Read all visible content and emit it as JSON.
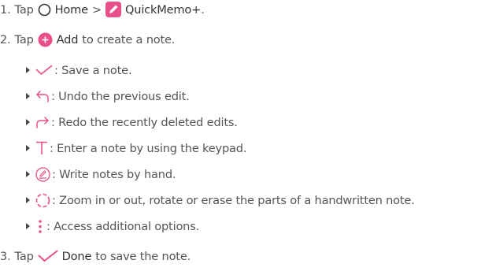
{
  "colors": {
    "accent": "#e94f8a",
    "text": "#555555",
    "strong": "#333333"
  },
  "steps": [
    {
      "num": "1.",
      "pre": "Tap",
      "home_label": "Home",
      "sep": ">",
      "app_label": "QuickMemo+",
      "post": "."
    },
    {
      "num": "2.",
      "pre": "Tap",
      "add_label": "Add",
      "post": "to create a note."
    },
    {
      "num": "3.",
      "pre": "Tap",
      "done_label": "Done",
      "post": "to save the note."
    }
  ],
  "bullets": [
    {
      "icon": "checkmark-icon",
      "text": ": Save a note."
    },
    {
      "icon": "undo-icon",
      "text": ": Undo the previous edit."
    },
    {
      "icon": "redo-icon",
      "text": ": Redo the recently deleted edits."
    },
    {
      "icon": "text-icon",
      "text": ": Enter a note by using the keypad."
    },
    {
      "icon": "pen-icon",
      "text": ": Write notes by hand."
    },
    {
      "icon": "lasso-icon",
      "text": ": Zoom in or out, rotate or erase the parts of a handwritten note."
    },
    {
      "icon": "more-options-icon",
      "text": ": Access additional options."
    }
  ]
}
